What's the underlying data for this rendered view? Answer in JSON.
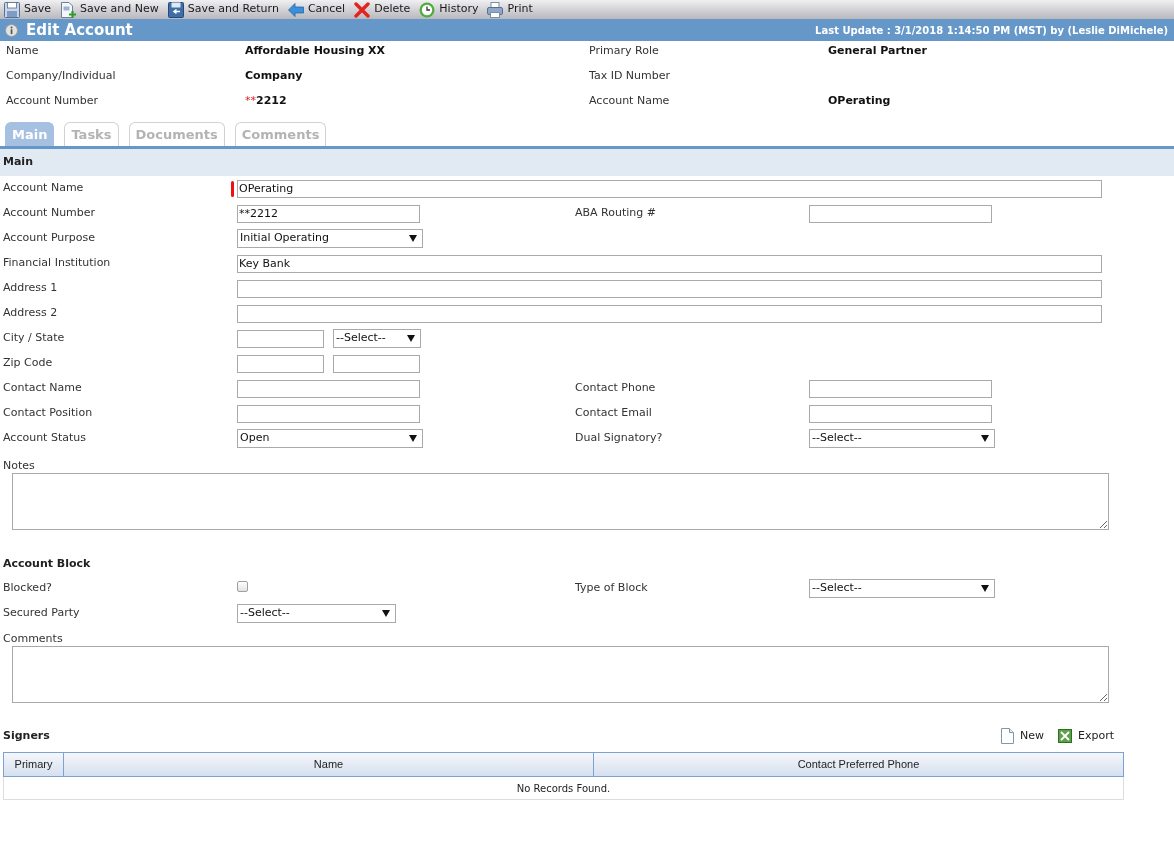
{
  "toolbar": [
    {
      "label": "Save",
      "kind": "save"
    },
    {
      "label": "Save and New",
      "kind": "save-new"
    },
    {
      "label": "Save and Return",
      "kind": "save-return"
    },
    {
      "label": "Cancel",
      "kind": "cancel"
    },
    {
      "label": "Delete",
      "kind": "delete"
    },
    {
      "label": "History",
      "kind": "history"
    },
    {
      "label": "Print",
      "kind": "print"
    }
  ],
  "header": {
    "title": "Edit Account",
    "last_update": "Last Update : 3/1/2018 1:14:50 PM (MST) by (Leslie DiMichele)"
  },
  "summary": {
    "rows": [
      [
        {
          "label": "Name",
          "value": "Affordable Housing XX"
        },
        {
          "label": "Primary Role",
          "value": "General Partner"
        }
      ],
      [
        {
          "label": "Company/Individual",
          "value": "Company"
        },
        {
          "label": "Tax ID Number"
        }
      ],
      [
        {
          "label": "Account Number",
          "mask": "**",
          "value": "2212"
        },
        {
          "label": "Account Name",
          "value": "OPerating"
        }
      ]
    ]
  },
  "tabs": [
    {
      "label": "Main",
      "selected": true
    },
    {
      "label": "Tasks",
      "selected": false
    },
    {
      "label": "Documents",
      "selected": false
    },
    {
      "label": "Comments",
      "selected": false
    }
  ],
  "section": {
    "title": "Main"
  },
  "form": {
    "rows": [
      {
        "left": {
          "label": "Account Name",
          "kind": "wide",
          "value": "OPerating",
          "required": true
        }
      },
      {
        "left": {
          "label": "Account Number",
          "kind": "text",
          "value": "**2212",
          "required": false
        },
        "right": {
          "label": "ABA Routing #",
          "kind": "text",
          "required": false
        }
      },
      {
        "left": {
          "label": "Account Purpose",
          "kind": "select",
          "value": "Initial Operating",
          "required": false
        }
      },
      {
        "left": {
          "label": "Financial Institution",
          "kind": "wide",
          "value": "Key Bank",
          "required": false
        }
      },
      {
        "left": {
          "label": "Address 1",
          "kind": "wide",
          "required": false
        }
      },
      {
        "left": {
          "label": "Address 2",
          "kind": "wide",
          "required": false
        }
      },
      {
        "left": {
          "label": "City / State",
          "kind": "pair",
          "required": false,
          "controls": [
            {
              "kind": "text"
            },
            {
              "kind": "select",
              "value": "--Select--"
            }
          ]
        }
      },
      {
        "left": {
          "label": "Zip Code",
          "kind": "pair",
          "required": false,
          "controls": [
            {
              "kind": "text"
            },
            {
              "kind": "text"
            }
          ]
        }
      },
      {
        "left": {
          "label": "Contact Name",
          "kind": "text",
          "required": false
        },
        "right": {
          "label": "Contact Phone",
          "kind": "text",
          "required": false
        }
      },
      {
        "left": {
          "label": "Contact Position",
          "kind": "text",
          "required": false
        },
        "right": {
          "label": "Contact Email",
          "kind": "text",
          "required": false
        }
      },
      {
        "left": {
          "label": "Account Status",
          "kind": "select",
          "value": "Open",
          "required": false
        },
        "right": {
          "label": "Dual Signatory?",
          "kind": "select",
          "value": "--Select--",
          "required": false
        }
      }
    ]
  },
  "notes": {
    "label": "Notes"
  },
  "account_block": {
    "title": "Account Block",
    "blocked": {
      "label": "Blocked?",
      "checked": false
    },
    "type_of_block": {
      "label": "Type of Block",
      "value": "--Select--"
    },
    "secured_party": {
      "label": "Secured Party",
      "value": "--Select--"
    }
  },
  "comments": {
    "label": "Comments"
  },
  "signers": {
    "title": "Signers",
    "actions": [
      {
        "label": "New",
        "kind": "new"
      },
      {
        "label": "Export",
        "kind": "export"
      }
    ],
    "columns": [
      "Primary",
      "Name",
      "Contact Preferred Phone"
    ],
    "empty_message": "No Records Found."
  }
}
